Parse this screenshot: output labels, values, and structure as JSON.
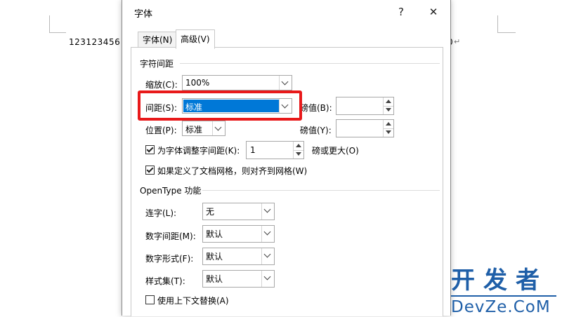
{
  "document": {
    "text": "123123456",
    "tail": "0",
    "para_mark": "↵"
  },
  "dialog": {
    "title": "字体",
    "help_label": "?",
    "close_label": "✕",
    "tabs": [
      {
        "label": "字体(N)"
      },
      {
        "label": "高级(V)"
      }
    ],
    "char_spacing": {
      "title": "字符间距",
      "scale_label": "缩放(C):",
      "scale_value": "100%",
      "spacing_label": "间距(S):",
      "spacing_value": "标准",
      "spacing_by_label": "磅值(B):",
      "spacing_by_value": "",
      "position_label": "位置(P):",
      "position_value": "标准",
      "position_by_label": "磅值(Y):",
      "position_by_value": "",
      "kerning_label": "为字体调整字间距(K):",
      "kerning_checked": true,
      "kerning_value": "1",
      "kerning_suffix": "磅或更大(O)",
      "grid_label": "如果定义了文档网格，则对齐到网格(W)",
      "grid_checked": true
    },
    "opentype": {
      "title": "OpenType 功能",
      "ligatures_label": "连字(L):",
      "ligatures_value": "无",
      "number_spacing_label": "数字间距(M):",
      "number_spacing_value": "默认",
      "number_forms_label": "数字形式(F):",
      "number_forms_value": "默认",
      "stylistic_sets_label": "样式集(T):",
      "stylistic_sets_value": "默认",
      "contextual_label": "使用上下文替换(A)",
      "contextual_checked": false
    }
  },
  "watermark": {
    "top": "开发者",
    "bottom": "DevZe.CoM"
  },
  "colors": {
    "highlight": "#e8191a",
    "selection": "#0078d7",
    "watermark": "#1f5fa8"
  }
}
